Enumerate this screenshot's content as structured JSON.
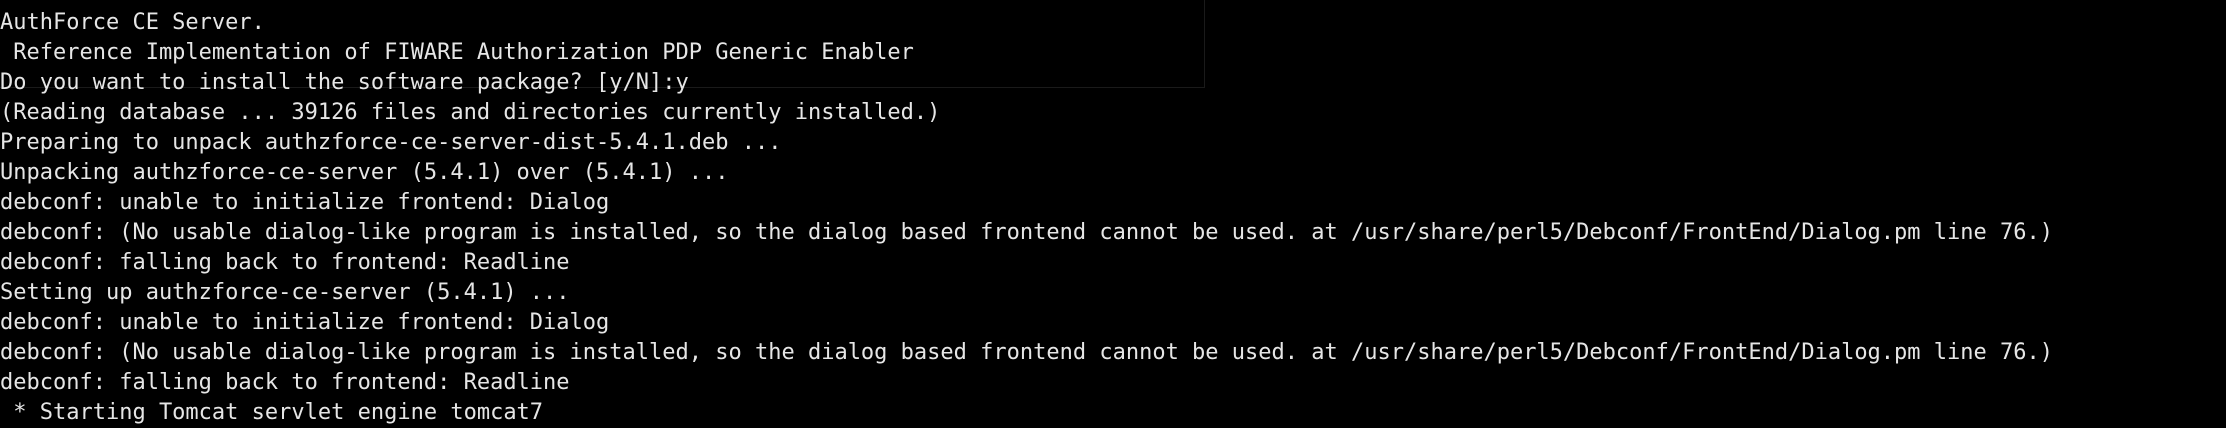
{
  "terminal": {
    "lines": [
      "AuthForce CE Server.",
      " Reference Implementation of FIWARE Authorization PDP Generic Enabler",
      "Do you want to install the software package? [y/N]:y",
      "(Reading database ... 39126 files and directories currently installed.)",
      "Preparing to unpack authzforce-ce-server-dist-5.4.1.deb ...",
      "Unpacking authzforce-ce-server (5.4.1) over (5.4.1) ...",
      "debconf: unable to initialize frontend: Dialog",
      "debconf: (No usable dialog-like program is installed, so the dialog based frontend cannot be used. at /usr/share/perl5/Debconf/FrontEnd/Dialog.pm line 76.)",
      "debconf: falling back to frontend: Readline",
      "Setting up authzforce-ce-server (5.4.1) ...",
      "debconf: unable to initialize frontend: Dialog",
      "debconf: (No usable dialog-like program is installed, so the dialog based frontend cannot be used. at /usr/share/perl5/Debconf/FrontEnd/Dialog.pm line 76.)",
      "debconf: falling back to frontend: Readline",
      " * Starting Tomcat servlet engine tomcat7"
    ]
  },
  "colors": {
    "background": "#000000",
    "text": "#e6e6e6"
  }
}
